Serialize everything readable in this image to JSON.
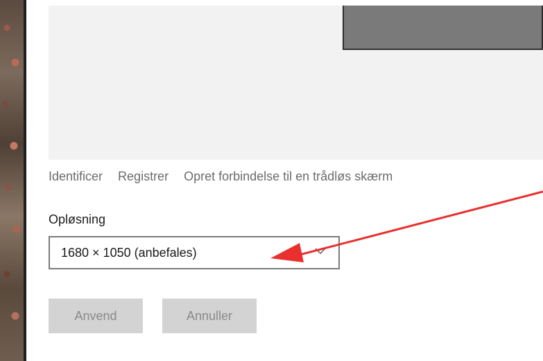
{
  "display_settings": {
    "links": {
      "identify": "Identificer",
      "detect": "Registrer",
      "connect_wireless": "Opret forbindelse til en trådløs skærm"
    },
    "resolution": {
      "label": "Opløsning",
      "selected_value": "1680 × 1050 (anbefales)"
    },
    "buttons": {
      "apply": "Anvend",
      "cancel": "Annuller"
    }
  },
  "icons": {
    "dropdown": "chevron-down-icon"
  },
  "colors": {
    "annotation_arrow": "#e8302e",
    "monitor_preview": "#7a7a7a",
    "disabled_button": "#d3d3d3"
  }
}
